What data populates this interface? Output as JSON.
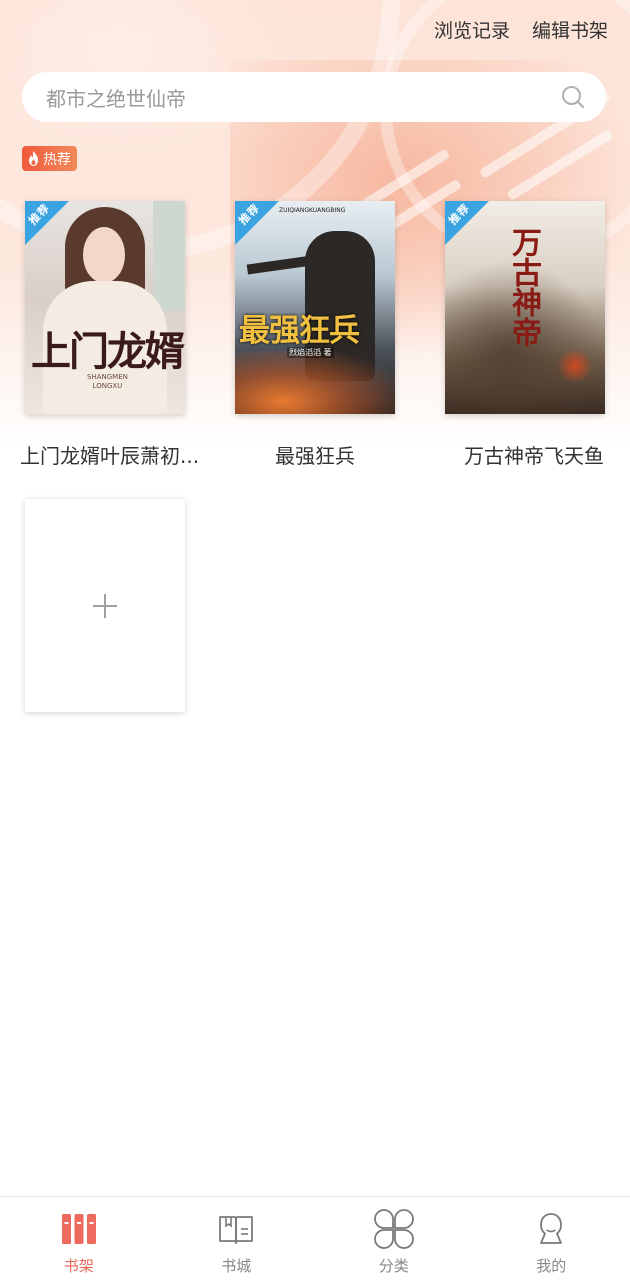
{
  "header": {
    "history_label": "浏览记录",
    "edit_label": "编辑书架"
  },
  "search": {
    "placeholder": "都市之绝世仙帝",
    "icon": "search-icon"
  },
  "hot_badge": {
    "label": "热荐",
    "icon": "flame-icon"
  },
  "books": [
    {
      "title": "上门龙婿叶辰萧初...",
      "tag": "推荐",
      "cover_title": "上门龙婿",
      "cover_subtitle_line1": "SHANGMEN",
      "cover_subtitle_line2": "LONGXU"
    },
    {
      "title": "最强狂兵",
      "tag": "推荐",
      "cover_title": "最强狂兵",
      "cover_subtitle": "ZUIQIANGKUANGBING",
      "cover_author": "烈焰滔滔 著"
    },
    {
      "title": "万古神帝飞天鱼",
      "tag": "推荐",
      "cover_title": "万古神帝"
    }
  ],
  "add_card": {
    "icon": "plus-icon"
  },
  "tabs": [
    {
      "label": "书架",
      "icon": "bookshelf-icon",
      "active": true
    },
    {
      "label": "书城",
      "icon": "open-book-icon",
      "active": false
    },
    {
      "label": "分类",
      "icon": "category-grid-icon",
      "active": false
    },
    {
      "label": "我的",
      "icon": "profile-icon",
      "active": false
    }
  ],
  "colors": {
    "accent": "#ea6a5a",
    "badge": "#f05a3c",
    "recommend_tag": "#3aa3e0",
    "hero_bg": "#fde3d8"
  }
}
